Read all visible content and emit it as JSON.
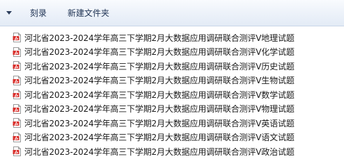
{
  "toolbar": {
    "burn_label": "刻录",
    "new_folder_label": "新建文件夹"
  },
  "files": [
    {
      "name": "河北省2023-2024学年高三下学期2月大数据应用调研联合测评Ⅴ地理试题",
      "icon": "pdf-icon"
    },
    {
      "name": "河北省2023-2024学年高三下学期2月大数据应用调研联合测评Ⅴ化学试题",
      "icon": "pdf-icon"
    },
    {
      "name": "河北省2023-2024学年高三下学期2月大数据应用调研联合测评Ⅴ历史试题",
      "icon": "pdf-icon"
    },
    {
      "name": "河北省2023-2024学年高三下学期2月大数据应用调研联合测评Ⅴ生物试题",
      "icon": "pdf-icon"
    },
    {
      "name": "河北省2023-2024学年高三下学期2月大数据应用调研联合测评Ⅴ数学试题",
      "icon": "pdf-icon"
    },
    {
      "name": "河北省2023-2024学年高三下学期2月大数据应用调研联合测评Ⅴ物理试题",
      "icon": "pdf-icon"
    },
    {
      "name": "河北省2023-2024学年高三下学期2月大数据应用调研联合测评Ⅴ英语试题",
      "icon": "pdf-icon"
    },
    {
      "name": "河北省2023-2024学年高三下学期2月大数据应用调研联合测评Ⅴ语文试题",
      "icon": "pdf-icon"
    },
    {
      "name": "河北省2023-2024学年高三下学期2月大数据应用调研联合测评Ⅴ政治试题",
      "icon": "pdf-icon"
    }
  ],
  "colors": {
    "pdf_icon": "#d9302c",
    "toolbar_text": "#1e3253"
  }
}
